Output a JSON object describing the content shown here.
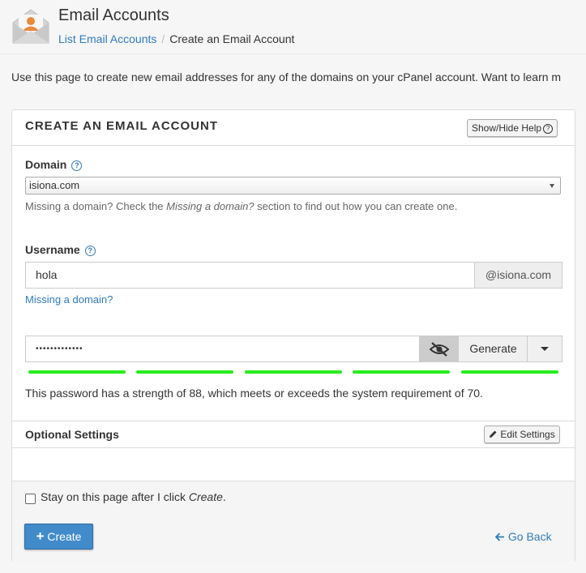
{
  "header": {
    "title": "Email Accounts",
    "breadcrumb": [
      "List Email Accounts",
      "Create an Email Account"
    ],
    "breadcrumb_separator": "/",
    "icon": "email-accounts-icon"
  },
  "intro": "Use this page to create new email addresses for any of the domains on your cPanel account. Want to learn m",
  "panel": {
    "title": "CREATE AN EMAIL ACCOUNT",
    "help_button": "Show/Hide Help",
    "domain": {
      "label": "Domain",
      "value": "isiona.com",
      "hint_pre": "Missing a domain? Check the ",
      "hint_em": "Missing a domain?",
      "hint_post": " section to find out how you can create one."
    },
    "username": {
      "label": "Username",
      "value": "hola",
      "suffix": "@isiona.com",
      "missing_link": "Missing a domain?"
    },
    "password": {
      "masked": "•••••••••••••",
      "generate_label": "Generate",
      "strength": 88,
      "required": 70,
      "strength_text": "This password has a strength of 88, which meets or exceeds the system requirement of 70.",
      "meter_color": "#27ed1c"
    },
    "optional": {
      "label": "Optional Settings",
      "edit_button": "Edit Settings"
    },
    "footer": {
      "stay_pre": "Stay on this page after I click ",
      "stay_em": "Create",
      "stay_post": ".",
      "create_label": "Create",
      "go_back_label": "Go Back"
    }
  },
  "colors": {
    "accent": "#428bca",
    "link": "#337ab7"
  }
}
